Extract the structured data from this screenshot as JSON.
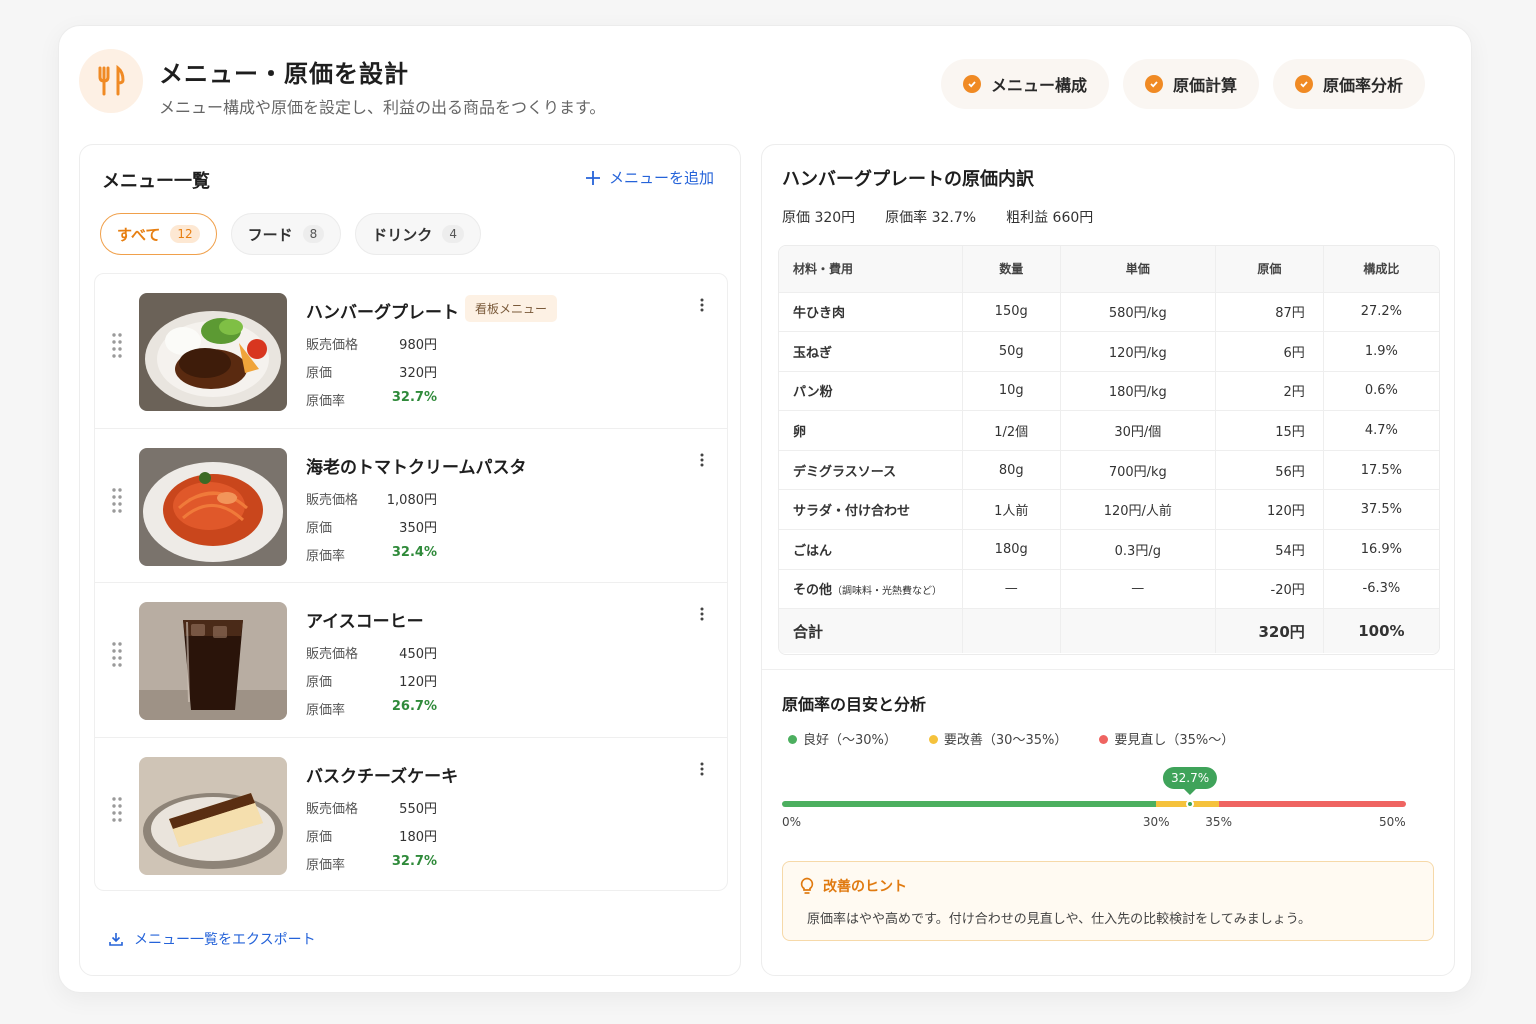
{
  "header": {
    "title": "メニュー・原価を設計",
    "subtitle": "メニュー構成や原価を設定し、利益の出る商品をつくります。",
    "steps": [
      "メニュー構成",
      "原価計算",
      "原価率分析"
    ]
  },
  "menu_panel": {
    "title": "メニュー一覧",
    "add_label": "メニューを追加",
    "tabs": [
      {
        "label": "すべて",
        "count": "12"
      },
      {
        "label": "フード",
        "count": "8"
      },
      {
        "label": "ドリンク",
        "count": "4"
      }
    ],
    "field_labels": {
      "price": "販売価格",
      "cost": "原価",
      "rate": "原価率"
    },
    "items": [
      {
        "name": "ハンバーグプレート",
        "badge": "看板メニュー",
        "price": "980円",
        "cost": "320円",
        "rate": "32.7%"
      },
      {
        "name": "海老のトマトクリームパスタ",
        "price": "1,080円",
        "cost": "350円",
        "rate": "32.4%"
      },
      {
        "name": "アイスコーヒー",
        "price": "450円",
        "cost": "120円",
        "rate": "26.7%"
      },
      {
        "name": "バスクチーズケーキ",
        "price": "550円",
        "cost": "180円",
        "rate": "32.7%"
      }
    ],
    "export_label": "メニュー一覧をエクスポート"
  },
  "breakdown": {
    "title": "ハンバーグプレートの原価内訳",
    "summary": [
      "原価 320円",
      "原価率 32.7%",
      "粗利益 660円"
    ],
    "columns": [
      "材料・費用",
      "数量",
      "単価",
      "原価",
      "構成比"
    ],
    "rows": [
      [
        "牛ひき肉",
        "150g",
        "580円/kg",
        "87円",
        "27.2%"
      ],
      [
        "玉ねぎ",
        "50g",
        "120円/kg",
        "6円",
        "1.9%"
      ],
      [
        "パン粉",
        "10g",
        "180円/kg",
        "2円",
        "0.6%"
      ],
      [
        "卵",
        "1/2個",
        "30円/個",
        "15円",
        "4.7%"
      ],
      [
        "デミグラスソース",
        "80g",
        "700円/kg",
        "56円",
        "17.5%"
      ],
      [
        "サラダ・付け合わせ",
        "1人前",
        "120円/人前",
        "120円",
        "37.5%"
      ],
      [
        "ごはん",
        "180g",
        "0.3円/g",
        "54円",
        "16.9%"
      ],
      [
        "その他",
        "—",
        "—",
        "-20円",
        "-6.3%"
      ]
    ],
    "other_note": "（調味料・光熱費など）",
    "total": {
      "label": "合計",
      "cost": "320円",
      "ratio": "100%"
    }
  },
  "analysis": {
    "title": "原価率の目安と分析",
    "legend": [
      {
        "label": "良好（〜30%）",
        "color": "#4caf5f"
      },
      {
        "label": "要改善（30〜35%）",
        "color": "#f5c23c"
      },
      {
        "label": "要見直し（35%〜）",
        "color": "#ef6461"
      }
    ],
    "scale": {
      "min": 0,
      "max": 50,
      "good_max": 30,
      "warn_max": 35,
      "value": 32.7
    },
    "marker_label": "32.7%",
    "ticks": [
      "0%",
      "30%",
      "35%",
      "50%"
    ],
    "hint_title": "改善のヒント",
    "hint_text": "原価率はやや高めです。付け合わせの見直しや、仕入先の比較検討をしてみましょう。"
  },
  "colors": {
    "accent": "#f08a24",
    "link": "#2563d9",
    "good": "#4caf5f",
    "warn": "#f5c23c",
    "bad": "#ef6461"
  }
}
